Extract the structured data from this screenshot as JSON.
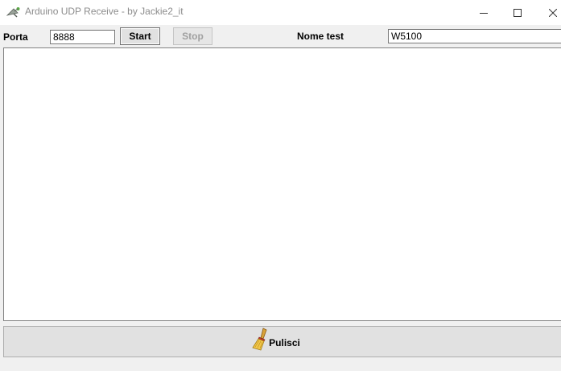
{
  "window": {
    "title": "Arduino UDP Receive - by Jackie2_it",
    "icons": {
      "app": "satellite-dish-icon",
      "minimize": "minimize-icon",
      "maximize": "maximize-icon",
      "close": "close-icon"
    }
  },
  "toolbar": {
    "port_label": "Porta",
    "port_value": "8888",
    "start_label": "Start",
    "stop_label": "Stop",
    "stop_enabled": false,
    "test_name_label": "Nome test",
    "test_name_value": "W5100"
  },
  "log": {
    "content": ""
  },
  "clear": {
    "label": "Pulisci",
    "icon": "broom-icon"
  },
  "colors": {
    "titlebar": "#ffffff",
    "window_bg": "#f0f0f0",
    "button_face": "#e1e1e1",
    "disabled_text": "#a0a0a0",
    "title_text": "#8c8c8c"
  }
}
